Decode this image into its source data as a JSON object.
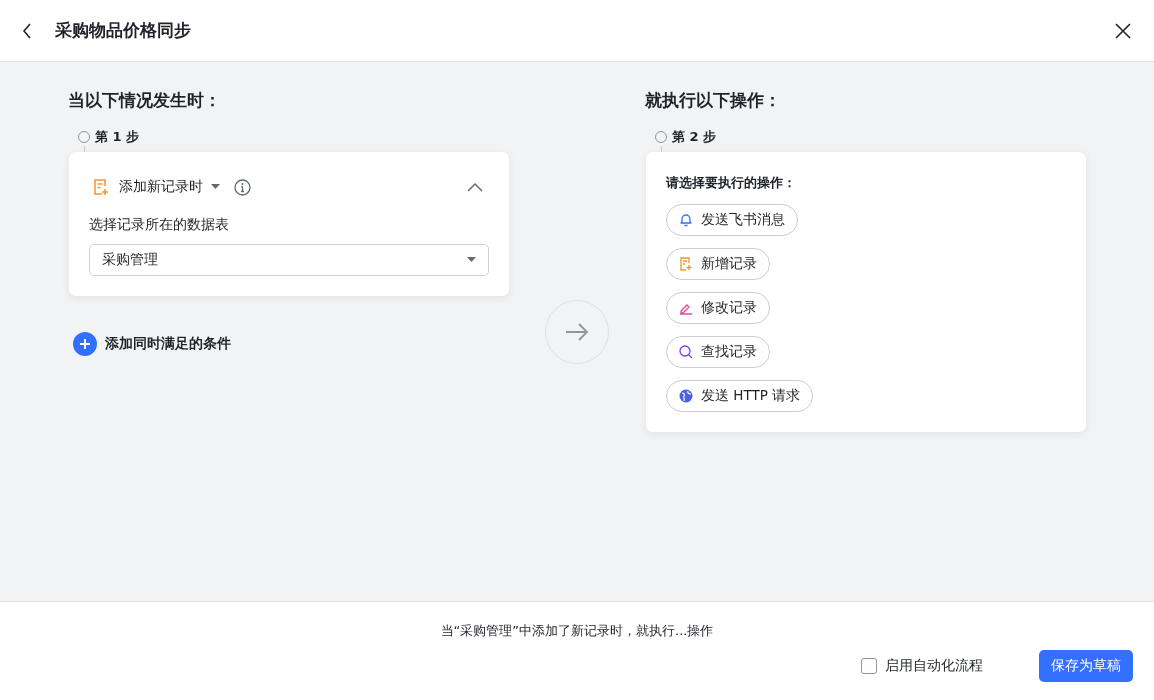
{
  "header": {
    "title": "采购物品价格同步"
  },
  "trigger": {
    "heading": "当以下情况发生时：",
    "step": "第 1 步",
    "event": "添加新记录时",
    "field_label": "选择记录所在的数据表",
    "table_value": "采购管理",
    "expanded": true,
    "add_condition": "添加同时满足的条件"
  },
  "action": {
    "heading": "就执行以下操作：",
    "step": "第 2 步",
    "prompt": "请选择要执行的操作：",
    "options": [
      {
        "kind": "bell",
        "label": "发送飞书消息"
      },
      {
        "kind": "record",
        "label": "新增记录"
      },
      {
        "kind": "edit",
        "label": "修改记录"
      },
      {
        "kind": "search",
        "label": "查找记录"
      },
      {
        "kind": "globe",
        "label": "发送 HTTP 请求"
      }
    ]
  },
  "footer": {
    "summary": "当“采购管理”中添加了新记录时，就执行...操作",
    "enable": {
      "label": "启用自动化流程",
      "checked": false
    },
    "save": "保存为草稿"
  }
}
